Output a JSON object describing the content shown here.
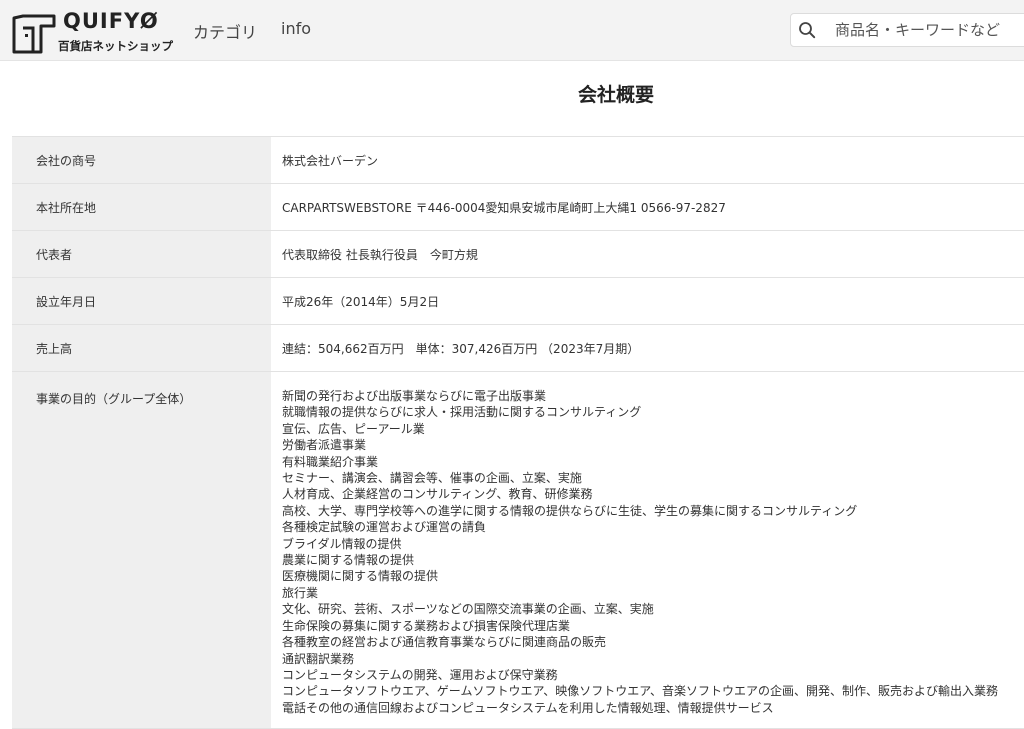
{
  "header": {
    "logo_word": "QUIFYØ",
    "logo_sub": "百貨店ネットショップ",
    "nav": [
      {
        "label": "カテゴリ"
      },
      {
        "label": "info"
      }
    ],
    "search": {
      "placeholder": "商品名・キーワードなど",
      "icon": "search-icon"
    }
  },
  "page": {
    "title": "会社概要"
  },
  "company": {
    "rows": [
      {
        "label": "会社の商号",
        "value": "株式会社バーデン"
      },
      {
        "label": "本社所在地",
        "value": "CARPARTSWEBSTORE 〒446-0004愛知県安城市尾崎町上大縄1 0566-97-2827"
      },
      {
        "label": "代表者",
        "value": "代表取締役 社長執行役員　今町方規"
      },
      {
        "label": "設立年月日",
        "value": "平成26年（2014年）5月2日"
      },
      {
        "label": "売上高",
        "value": "連結：504,662百万円　単体：307,426百万円 （2023年7月期）"
      }
    ],
    "purpose": {
      "label": "事業の目的（グループ全体）",
      "lines": [
        "新聞の発行および出版事業ならびに電子出版事業",
        "就職情報の提供ならびに求人・採用活動に関するコンサルティング",
        "宣伝、広告、ピーアール業",
        "労働者派遣事業",
        "有料職業紹介事業",
        "セミナー、講演会、講習会等、催事の企画、立案、実施",
        "人材育成、企業経営のコンサルティング、教育、研修業務",
        "高校、大学、専門学校等への進学に関する情報の提供ならびに生徒、学生の募集に関するコンサルティング",
        "各種検定試験の運営および運営の請負",
        "ブライダル情報の提供",
        "農業に関する情報の提供",
        "医療機関に関する情報の提供",
        "旅行業",
        "文化、研究、芸術、スポーツなどの国際交流事業の企画、立案、実施",
        "生命保険の募集に関する業務および損害保険代理店業",
        "各種教室の経営および通信教育事業ならびに関連商品の販売",
        "通訳翻訳業務",
        "コンピュータシステムの開発、運用および保守業務",
        "コンピュータソフトウエア、ゲームソフトウエア、映像ソフトウエア、音楽ソフトウエアの企画、開発、制作、販売および輸出入業務",
        "電話その他の通信回線およびコンピュータシステムを利用した情報処理、情報提供サービス"
      ]
    }
  }
}
